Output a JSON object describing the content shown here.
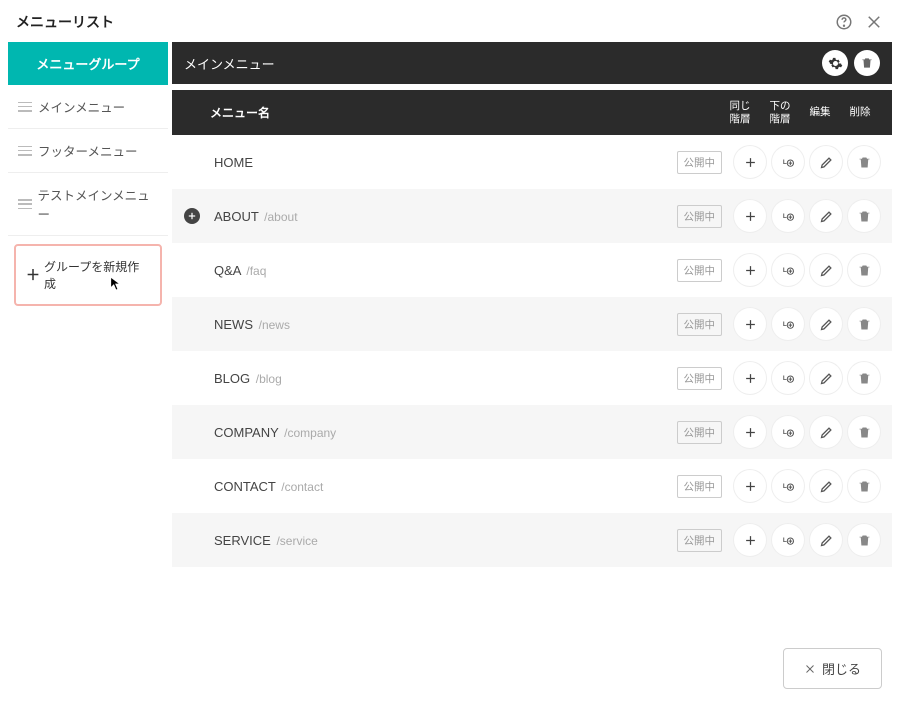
{
  "header": {
    "title": "メニューリスト"
  },
  "sidebar": {
    "tab_label": "メニューグループ",
    "groups": [
      {
        "label": "メインメニュー"
      },
      {
        "label": "フッターメニュー"
      },
      {
        "label": "テストメインメニュー"
      }
    ],
    "new_group_label": "グループを新規作成"
  },
  "main": {
    "title": "メインメニュー",
    "columns": {
      "name": "メニュー名",
      "same_level": "同じ\n階層",
      "sub_level": "下の\n階層",
      "edit": "編集",
      "delete": "削除"
    },
    "status_label": "公開中",
    "items": [
      {
        "name": "HOME",
        "slug": "",
        "expandable": false
      },
      {
        "name": "ABOUT",
        "slug": "/about",
        "expandable": true
      },
      {
        "name": "Q&A",
        "slug": "/faq",
        "expandable": false
      },
      {
        "name": "NEWS",
        "slug": "/news",
        "expandable": false
      },
      {
        "name": "BLOG",
        "slug": "/blog",
        "expandable": false
      },
      {
        "name": "COMPANY",
        "slug": "/company",
        "expandable": false
      },
      {
        "name": "CONTACT",
        "slug": "/contact",
        "expandable": false
      },
      {
        "name": "SERVICE",
        "slug": "/service",
        "expandable": false
      }
    ]
  },
  "footer": {
    "close_label": "閉じる"
  }
}
